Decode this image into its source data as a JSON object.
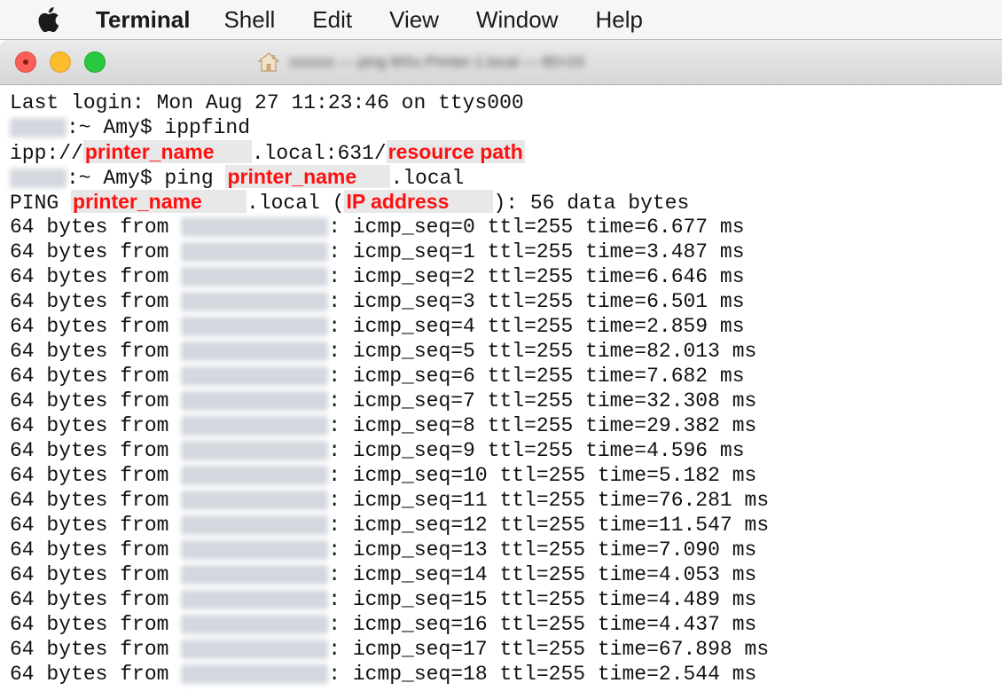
{
  "menubar": {
    "app_name": "Terminal",
    "items": [
      "Shell",
      "Edit",
      "View",
      "Window",
      "Help"
    ]
  },
  "window": {
    "title": "xxxxxx — ping MXx-Printer-1.local — 80×24"
  },
  "annotations": {
    "printer_name": "printer_name",
    "resource_path": "resource path",
    "ip_address": "IP address"
  },
  "terminal": {
    "last_login": "Last login: Mon Aug 27 11:23:46 on ttys000",
    "prompt_suffix": ":~ Amy$ ",
    "cmd_ippfind": "ippfind",
    "ipp_prefix": "ipp://",
    "ipp_middle": ".local:631/",
    "cmd_ping": "ping ",
    "local_suffix": ".local",
    "ping_prefix": "PING ",
    "ping_middle": ".local (",
    "ping_suffix": "): 56 data bytes",
    "bytes_prefix": "64 bytes from ",
    "ping_replies": [
      ": icmp_seq=0 ttl=255 time=6.677 ms",
      ": icmp_seq=1 ttl=255 time=3.487 ms",
      ": icmp_seq=2 ttl=255 time=6.646 ms",
      ": icmp_seq=3 ttl=255 time=6.501 ms",
      ": icmp_seq=4 ttl=255 time=2.859 ms",
      ": icmp_seq=5 ttl=255 time=82.013 ms",
      ": icmp_seq=6 ttl=255 time=7.682 ms",
      ": icmp_seq=7 ttl=255 time=32.308 ms",
      ": icmp_seq=8 ttl=255 time=29.382 ms",
      ": icmp_seq=9 ttl=255 time=4.596 ms",
      ": icmp_seq=10 ttl=255 time=5.182 ms",
      ": icmp_seq=11 ttl=255 time=76.281 ms",
      ": icmp_seq=12 ttl=255 time=11.547 ms",
      ": icmp_seq=13 ttl=255 time=7.090 ms",
      ": icmp_seq=14 ttl=255 time=4.053 ms",
      ": icmp_seq=15 ttl=255 time=4.489 ms",
      ": icmp_seq=16 ttl=255 time=4.437 ms",
      ": icmp_seq=17 ttl=255 time=67.898 ms",
      ": icmp_seq=18 ttl=255 time=2.544 ms"
    ]
  }
}
